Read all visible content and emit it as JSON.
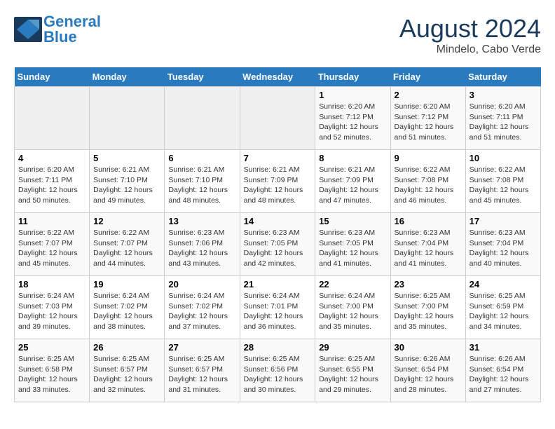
{
  "header": {
    "logo_line1": "General",
    "logo_line2": "Blue",
    "month_year": "August 2024",
    "location": "Mindelo, Cabo Verde"
  },
  "days_of_week": [
    "Sunday",
    "Monday",
    "Tuesday",
    "Wednesday",
    "Thursday",
    "Friday",
    "Saturday"
  ],
  "weeks": [
    [
      {
        "day": "",
        "info": ""
      },
      {
        "day": "",
        "info": ""
      },
      {
        "day": "",
        "info": ""
      },
      {
        "day": "",
        "info": ""
      },
      {
        "day": "1",
        "info": "Sunrise: 6:20 AM\nSunset: 7:12 PM\nDaylight: 12 hours\nand 52 minutes."
      },
      {
        "day": "2",
        "info": "Sunrise: 6:20 AM\nSunset: 7:12 PM\nDaylight: 12 hours\nand 51 minutes."
      },
      {
        "day": "3",
        "info": "Sunrise: 6:20 AM\nSunset: 7:11 PM\nDaylight: 12 hours\nand 51 minutes."
      }
    ],
    [
      {
        "day": "4",
        "info": "Sunrise: 6:20 AM\nSunset: 7:11 PM\nDaylight: 12 hours\nand 50 minutes."
      },
      {
        "day": "5",
        "info": "Sunrise: 6:21 AM\nSunset: 7:10 PM\nDaylight: 12 hours\nand 49 minutes."
      },
      {
        "day": "6",
        "info": "Sunrise: 6:21 AM\nSunset: 7:10 PM\nDaylight: 12 hours\nand 48 minutes."
      },
      {
        "day": "7",
        "info": "Sunrise: 6:21 AM\nSunset: 7:09 PM\nDaylight: 12 hours\nand 48 minutes."
      },
      {
        "day": "8",
        "info": "Sunrise: 6:21 AM\nSunset: 7:09 PM\nDaylight: 12 hours\nand 47 minutes."
      },
      {
        "day": "9",
        "info": "Sunrise: 6:22 AM\nSunset: 7:08 PM\nDaylight: 12 hours\nand 46 minutes."
      },
      {
        "day": "10",
        "info": "Sunrise: 6:22 AM\nSunset: 7:08 PM\nDaylight: 12 hours\nand 45 minutes."
      }
    ],
    [
      {
        "day": "11",
        "info": "Sunrise: 6:22 AM\nSunset: 7:07 PM\nDaylight: 12 hours\nand 45 minutes."
      },
      {
        "day": "12",
        "info": "Sunrise: 6:22 AM\nSunset: 7:07 PM\nDaylight: 12 hours\nand 44 minutes."
      },
      {
        "day": "13",
        "info": "Sunrise: 6:23 AM\nSunset: 7:06 PM\nDaylight: 12 hours\nand 43 minutes."
      },
      {
        "day": "14",
        "info": "Sunrise: 6:23 AM\nSunset: 7:05 PM\nDaylight: 12 hours\nand 42 minutes."
      },
      {
        "day": "15",
        "info": "Sunrise: 6:23 AM\nSunset: 7:05 PM\nDaylight: 12 hours\nand 41 minutes."
      },
      {
        "day": "16",
        "info": "Sunrise: 6:23 AM\nSunset: 7:04 PM\nDaylight: 12 hours\nand 41 minutes."
      },
      {
        "day": "17",
        "info": "Sunrise: 6:23 AM\nSunset: 7:04 PM\nDaylight: 12 hours\nand 40 minutes."
      }
    ],
    [
      {
        "day": "18",
        "info": "Sunrise: 6:24 AM\nSunset: 7:03 PM\nDaylight: 12 hours\nand 39 minutes."
      },
      {
        "day": "19",
        "info": "Sunrise: 6:24 AM\nSunset: 7:02 PM\nDaylight: 12 hours\nand 38 minutes."
      },
      {
        "day": "20",
        "info": "Sunrise: 6:24 AM\nSunset: 7:02 PM\nDaylight: 12 hours\nand 37 minutes."
      },
      {
        "day": "21",
        "info": "Sunrise: 6:24 AM\nSunset: 7:01 PM\nDaylight: 12 hours\nand 36 minutes."
      },
      {
        "day": "22",
        "info": "Sunrise: 6:24 AM\nSunset: 7:00 PM\nDaylight: 12 hours\nand 35 minutes."
      },
      {
        "day": "23",
        "info": "Sunrise: 6:25 AM\nSunset: 7:00 PM\nDaylight: 12 hours\nand 35 minutes."
      },
      {
        "day": "24",
        "info": "Sunrise: 6:25 AM\nSunset: 6:59 PM\nDaylight: 12 hours\nand 34 minutes."
      }
    ],
    [
      {
        "day": "25",
        "info": "Sunrise: 6:25 AM\nSunset: 6:58 PM\nDaylight: 12 hours\nand 33 minutes."
      },
      {
        "day": "26",
        "info": "Sunrise: 6:25 AM\nSunset: 6:57 PM\nDaylight: 12 hours\nand 32 minutes."
      },
      {
        "day": "27",
        "info": "Sunrise: 6:25 AM\nSunset: 6:57 PM\nDaylight: 12 hours\nand 31 minutes."
      },
      {
        "day": "28",
        "info": "Sunrise: 6:25 AM\nSunset: 6:56 PM\nDaylight: 12 hours\nand 30 minutes."
      },
      {
        "day": "29",
        "info": "Sunrise: 6:25 AM\nSunset: 6:55 PM\nDaylight: 12 hours\nand 29 minutes."
      },
      {
        "day": "30",
        "info": "Sunrise: 6:26 AM\nSunset: 6:54 PM\nDaylight: 12 hours\nand 28 minutes."
      },
      {
        "day": "31",
        "info": "Sunrise: 6:26 AM\nSunset: 6:54 PM\nDaylight: 12 hours\nand 27 minutes."
      }
    ]
  ]
}
